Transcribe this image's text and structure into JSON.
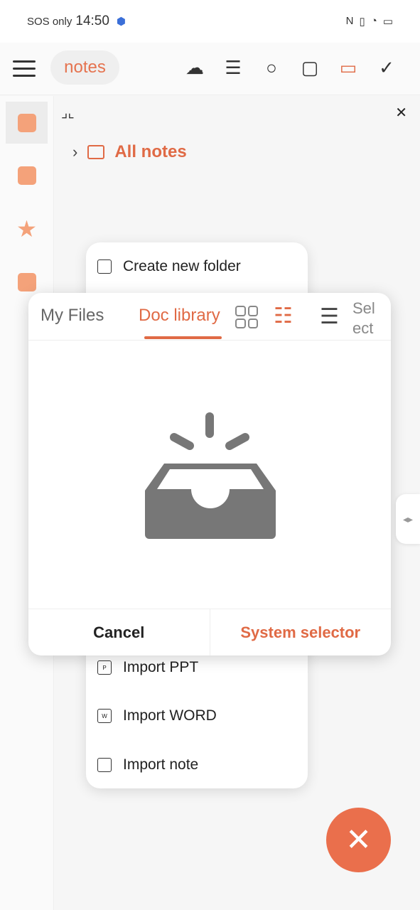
{
  "status_bar": {
    "carrier": "SOS only",
    "time": "14:50"
  },
  "toolbar": {
    "title": "notes",
    "icons": [
      "menu-icon",
      "cloud-user-icon",
      "sort-icon",
      "search-icon",
      "wallet-icon",
      "folder-icon",
      "check-circle-icon"
    ]
  },
  "breadcrumb": {
    "label": "All notes"
  },
  "popup_menu": {
    "items": [
      {
        "label": "Create new folder",
        "icon": "folder-icon"
      },
      {
        "label": "Import PPT",
        "icon": "ppt-file-icon",
        "badge": "P"
      },
      {
        "label": "Import WORD",
        "icon": "word-file-icon",
        "badge": "W"
      },
      {
        "label": "Import note",
        "icon": "note-import-icon"
      }
    ]
  },
  "dialog": {
    "tabs": [
      {
        "label": "My Files"
      },
      {
        "label": "Doc library",
        "active": true
      }
    ],
    "select_label": "Select",
    "cancel": "Cancel",
    "system_selector": "System selector"
  },
  "colors": {
    "accent": "#e06a45",
    "fab": "#ea6f4c"
  }
}
